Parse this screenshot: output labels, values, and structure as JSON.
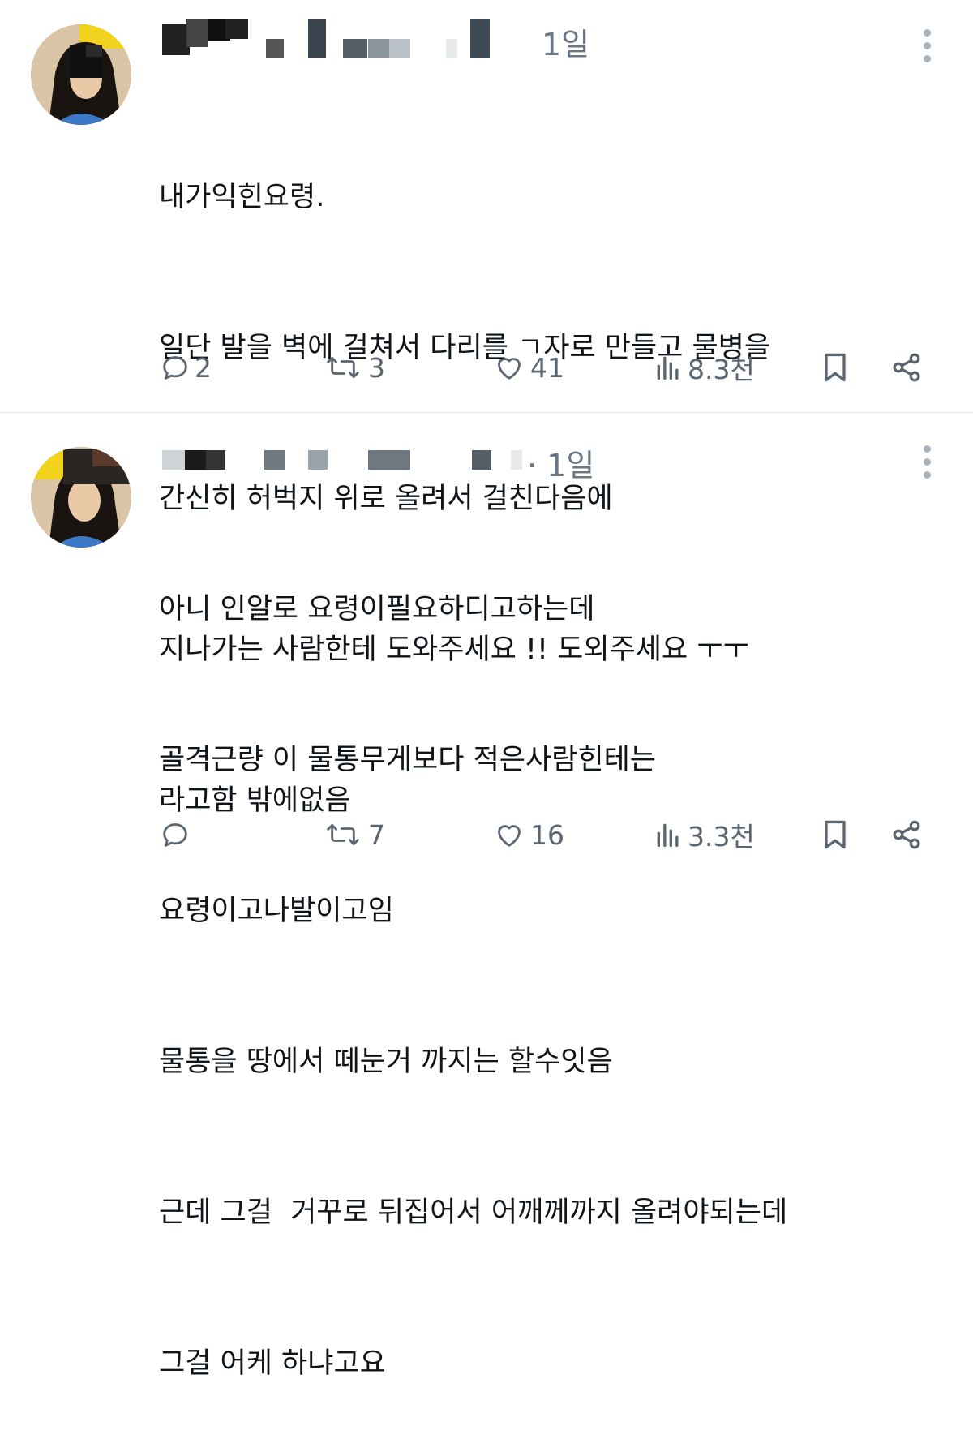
{
  "posts": [
    {
      "time": "1일",
      "lines": [
        "내가익힌요령.",
        "일단 발을 벽에 걸쳐서 다리를 ㄱ자로 만들고 물병을",
        "간신히 허벅지 위로 올려서 걸친다음에",
        "지나가는 사람한테 도와주세요 !! 도외주세요 ㅜㅜ",
        "라고함 밖에없음"
      ],
      "replies": "2",
      "reposts": "3",
      "likes": "41",
      "views": "8.3천"
    },
    {
      "time": "· 1일",
      "lines": [
        "아니 인알로 요령이필요하디고하는데",
        "골격근량 이 물통무게보다 적은사람힌테는",
        "요령이고나발이고임",
        "물통을 땅에서 떼눈거 까지는 할수잇음",
        "근데 그걸  거꾸로 뒤집어서 어깨께까지 올려야되는데",
        "그걸 어케 하냐고요"
      ],
      "replies": "",
      "reposts": "7",
      "likes": "16",
      "views": "3.3천"
    }
  ],
  "icons": {
    "reply": "speech-bubble-icon",
    "repost": "repost-arrows-icon",
    "like": "heart-icon",
    "views": "bar-chart-icon",
    "bookmark": "bookmark-icon",
    "share": "share-icon",
    "more": "vertical-dots-icon"
  },
  "colors": {
    "icon_gray": "#5b6670",
    "time_gray": "#6b7784",
    "text": "#0f1419"
  }
}
